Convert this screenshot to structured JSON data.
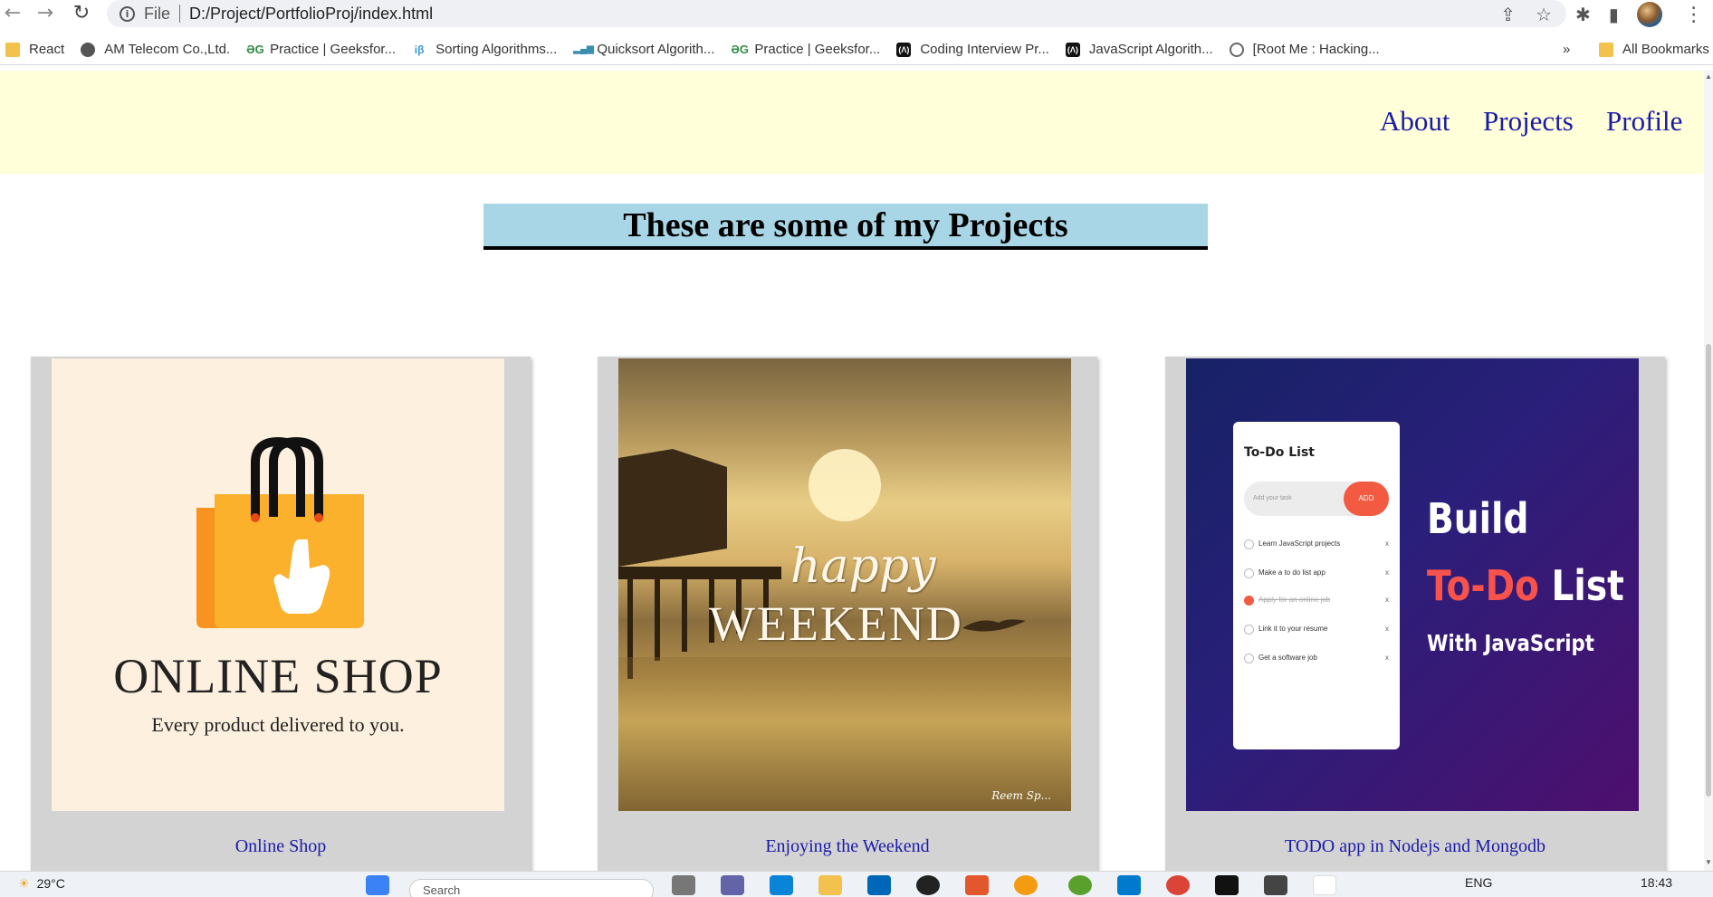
{
  "browser": {
    "file_label": "File",
    "url": "D:/Project/PortfolioProj/index.html",
    "bookmarks": [
      {
        "label": "React",
        "icon": "folder-icon"
      },
      {
        "label": "AM Telecom Co.,Ltd.",
        "icon": "globe-icon"
      },
      {
        "label": "Practice | Geeksfor...",
        "icon": "gfg-icon"
      },
      {
        "label": "Sorting Algorithms...",
        "icon": "ib-icon"
      },
      {
        "label": "Quicksort Algorith...",
        "icon": "chart-icon"
      },
      {
        "label": "Practice | Geeksfor...",
        "icon": "gfg-icon"
      },
      {
        "label": "Coding Interview Pr...",
        "icon": "ctio-icon"
      },
      {
        "label": "JavaScript Algorith...",
        "icon": "ctio-icon"
      },
      {
        "label": "[Root Me : Hacking...",
        "icon": "rootme-icon"
      }
    ],
    "more": "»",
    "all_bookmarks": "All Bookmarks"
  },
  "nav": {
    "about": "About",
    "projects": "Projects",
    "profile": "Profile"
  },
  "main": {
    "heading": "These are some of my Projects",
    "cards": [
      {
        "caption": "Online Shop",
        "image_title": "ONLINE SHOP",
        "image_subtitle": "Every product delivered to you."
      },
      {
        "caption": "Enjoying the Weekend",
        "image_line1": "happy",
        "image_line2": "WEEKEND",
        "signature": "Reem Sp..."
      },
      {
        "caption": "TODO app in Nodejs and Mongodb",
        "panel_title": "To-Do List",
        "input_placeholder": "Add your task",
        "add_label": "ADD",
        "items": [
          "Learn JavaScript projects",
          "Make a to do list app",
          "Apply for an online job",
          "Link it to your resume",
          "Get a software job"
        ],
        "build": "Build",
        "todo": "To-Do",
        "list": "List",
        "with_js": "With JavaScript"
      }
    ]
  },
  "taskbar": {
    "temperature": "29°C",
    "search_placeholder": "Search",
    "language": "ENG",
    "time": "18:43"
  },
  "colors": {
    "header_bg": "#ffffd9",
    "heading_bg": "#a9d6e6",
    "card_bg": "#d3d3d3",
    "link": "#1a1aa8"
  }
}
